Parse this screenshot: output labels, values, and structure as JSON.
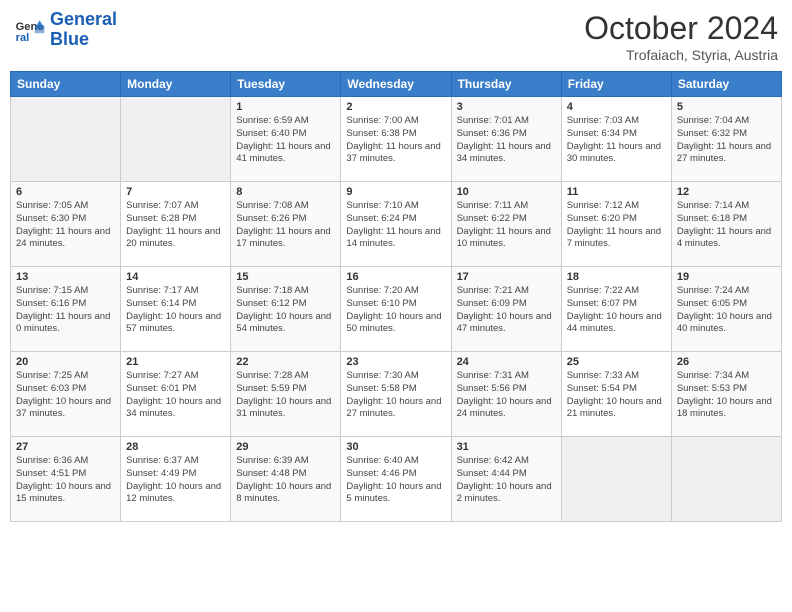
{
  "header": {
    "logo_line1": "General",
    "logo_line2": "Blue",
    "month": "October 2024",
    "location": "Trofaiach, Styria, Austria"
  },
  "weekdays": [
    "Sunday",
    "Monday",
    "Tuesday",
    "Wednesday",
    "Thursday",
    "Friday",
    "Saturday"
  ],
  "weeks": [
    [
      {
        "day": "",
        "info": ""
      },
      {
        "day": "",
        "info": ""
      },
      {
        "day": "1",
        "info": "Sunrise: 6:59 AM\nSunset: 6:40 PM\nDaylight: 11 hours and 41 minutes."
      },
      {
        "day": "2",
        "info": "Sunrise: 7:00 AM\nSunset: 6:38 PM\nDaylight: 11 hours and 37 minutes."
      },
      {
        "day": "3",
        "info": "Sunrise: 7:01 AM\nSunset: 6:36 PM\nDaylight: 11 hours and 34 minutes."
      },
      {
        "day": "4",
        "info": "Sunrise: 7:03 AM\nSunset: 6:34 PM\nDaylight: 11 hours and 30 minutes."
      },
      {
        "day": "5",
        "info": "Sunrise: 7:04 AM\nSunset: 6:32 PM\nDaylight: 11 hours and 27 minutes."
      }
    ],
    [
      {
        "day": "6",
        "info": "Sunrise: 7:05 AM\nSunset: 6:30 PM\nDaylight: 11 hours and 24 minutes."
      },
      {
        "day": "7",
        "info": "Sunrise: 7:07 AM\nSunset: 6:28 PM\nDaylight: 11 hours and 20 minutes."
      },
      {
        "day": "8",
        "info": "Sunrise: 7:08 AM\nSunset: 6:26 PM\nDaylight: 11 hours and 17 minutes."
      },
      {
        "day": "9",
        "info": "Sunrise: 7:10 AM\nSunset: 6:24 PM\nDaylight: 11 hours and 14 minutes."
      },
      {
        "day": "10",
        "info": "Sunrise: 7:11 AM\nSunset: 6:22 PM\nDaylight: 11 hours and 10 minutes."
      },
      {
        "day": "11",
        "info": "Sunrise: 7:12 AM\nSunset: 6:20 PM\nDaylight: 11 hours and 7 minutes."
      },
      {
        "day": "12",
        "info": "Sunrise: 7:14 AM\nSunset: 6:18 PM\nDaylight: 11 hours and 4 minutes."
      }
    ],
    [
      {
        "day": "13",
        "info": "Sunrise: 7:15 AM\nSunset: 6:16 PM\nDaylight: 11 hours and 0 minutes."
      },
      {
        "day": "14",
        "info": "Sunrise: 7:17 AM\nSunset: 6:14 PM\nDaylight: 10 hours and 57 minutes."
      },
      {
        "day": "15",
        "info": "Sunrise: 7:18 AM\nSunset: 6:12 PM\nDaylight: 10 hours and 54 minutes."
      },
      {
        "day": "16",
        "info": "Sunrise: 7:20 AM\nSunset: 6:10 PM\nDaylight: 10 hours and 50 minutes."
      },
      {
        "day": "17",
        "info": "Sunrise: 7:21 AM\nSunset: 6:09 PM\nDaylight: 10 hours and 47 minutes."
      },
      {
        "day": "18",
        "info": "Sunrise: 7:22 AM\nSunset: 6:07 PM\nDaylight: 10 hours and 44 minutes."
      },
      {
        "day": "19",
        "info": "Sunrise: 7:24 AM\nSunset: 6:05 PM\nDaylight: 10 hours and 40 minutes."
      }
    ],
    [
      {
        "day": "20",
        "info": "Sunrise: 7:25 AM\nSunset: 6:03 PM\nDaylight: 10 hours and 37 minutes."
      },
      {
        "day": "21",
        "info": "Sunrise: 7:27 AM\nSunset: 6:01 PM\nDaylight: 10 hours and 34 minutes."
      },
      {
        "day": "22",
        "info": "Sunrise: 7:28 AM\nSunset: 5:59 PM\nDaylight: 10 hours and 31 minutes."
      },
      {
        "day": "23",
        "info": "Sunrise: 7:30 AM\nSunset: 5:58 PM\nDaylight: 10 hours and 27 minutes."
      },
      {
        "day": "24",
        "info": "Sunrise: 7:31 AM\nSunset: 5:56 PM\nDaylight: 10 hours and 24 minutes."
      },
      {
        "day": "25",
        "info": "Sunrise: 7:33 AM\nSunset: 5:54 PM\nDaylight: 10 hours and 21 minutes."
      },
      {
        "day": "26",
        "info": "Sunrise: 7:34 AM\nSunset: 5:53 PM\nDaylight: 10 hours and 18 minutes."
      }
    ],
    [
      {
        "day": "27",
        "info": "Sunrise: 6:36 AM\nSunset: 4:51 PM\nDaylight: 10 hours and 15 minutes."
      },
      {
        "day": "28",
        "info": "Sunrise: 6:37 AM\nSunset: 4:49 PM\nDaylight: 10 hours and 12 minutes."
      },
      {
        "day": "29",
        "info": "Sunrise: 6:39 AM\nSunset: 4:48 PM\nDaylight: 10 hours and 8 minutes."
      },
      {
        "day": "30",
        "info": "Sunrise: 6:40 AM\nSunset: 4:46 PM\nDaylight: 10 hours and 5 minutes."
      },
      {
        "day": "31",
        "info": "Sunrise: 6:42 AM\nSunset: 4:44 PM\nDaylight: 10 hours and 2 minutes."
      },
      {
        "day": "",
        "info": ""
      },
      {
        "day": "",
        "info": ""
      }
    ]
  ]
}
